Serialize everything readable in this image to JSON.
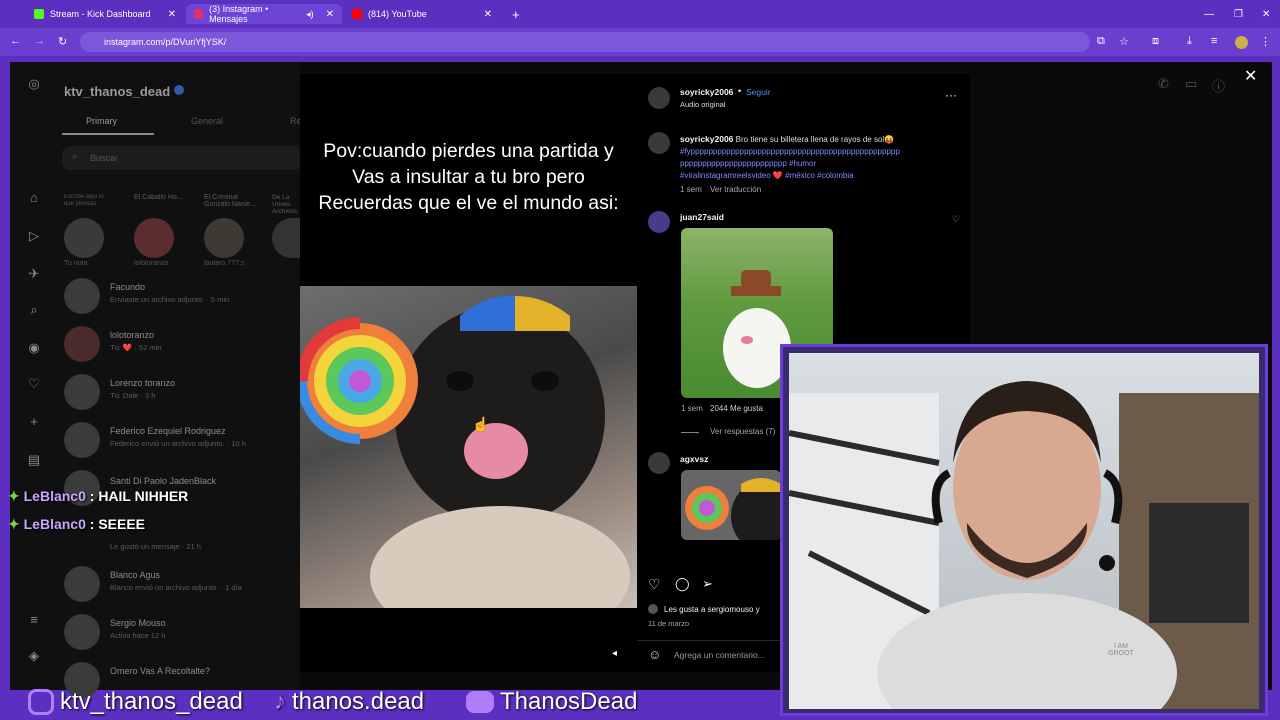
{
  "tabs": [
    {
      "label": "Stream - Kick Dashboard",
      "active": false
    },
    {
      "label": "(3) Instagram • Mensajes",
      "active": true
    },
    {
      "label": "(814) YouTube",
      "active": false
    }
  ],
  "address": {
    "url": "instagram.com/p/DVuriYfjYSK/"
  },
  "dm": {
    "username": "ktv_thanos_dead",
    "tabs": [
      "Primary",
      "General",
      "Re"
    ],
    "search_placeholder": "Buscar",
    "notes": [
      {
        "name": "Tu nota",
        "note": "Escribe aquí lo que piensas"
      },
      {
        "name": "lolotoranzo",
        "note": "El Caballo Ho..."
      },
      {
        "name": "lautaro.777.s",
        "note": "El Criminal Gonzalo Nasie..."
      },
      {
        "name": "",
        "note": "De La Urives Archivos"
      }
    ],
    "threads": [
      {
        "name": "Facundo",
        "sub": "Enviaste un archivo adjunto. · 5 min"
      },
      {
        "name": "lolotoranzo",
        "sub": "Tú: ❤️ · 52 min"
      },
      {
        "name": "Lorenzo toranzo",
        "sub": "Tú: Dale · 3 h"
      },
      {
        "name": "Federico Ezequiel Rodriguez",
        "sub": "Federico envió un archivo adjunto. · 10 h"
      },
      {
        "name": "Santi Di Paolo JadenBlack",
        "sub": ""
      },
      {
        "name": "",
        "sub": "Le gustó un mensaje · 21 h"
      },
      {
        "name": "Blanco Agus",
        "sub": "Blanco envió un archivo adjunto. · 1 día"
      },
      {
        "name": "Sergio Mouso",
        "sub": "Activo hace 12 h"
      },
      {
        "name": "Omero Vas A Recoltalte?",
        "sub": ""
      }
    ]
  },
  "reel": {
    "caption_lines": [
      "Pov:cuando pierdes una partida y",
      "Vas a insultar a tu bro pero",
      "Recuerdas que el ve el mundo asi:"
    ]
  },
  "post": {
    "author": "soyricky2006",
    "follow": "Seguir",
    "audio": "Audio original",
    "caption_author": "soyricky2006",
    "caption_text": "Bro tiene su billetera llena de rayos de sol😝",
    "hashtags_line1": "#fyppppppppppppppppppppppppppppppppppppppppppppppp",
    "hashtags_line2": "pppppppppppppppppppppppp #humor",
    "hashtags_line3": "#viralinstagramreelsvideo ❤️ #méxico #colombia",
    "caption_time": "1 sem",
    "translate": "Ver traducción",
    "comments": [
      {
        "user": "juan27said",
        "time": "1 sem",
        "likes": "2044 Me gusta",
        "replies": "Ver respuestas (7)"
      },
      {
        "user": "agxvsz"
      }
    ],
    "liked_by": "Les gusta a sergiomouso y",
    "date": "11 de marzo",
    "comment_placeholder": "Agrega un comentario..."
  },
  "chat": [
    {
      "user": "LeBlanc0",
      "text": ": HAIL NIHHER"
    },
    {
      "user": "LeBlanc0",
      "text": ": SEEEE"
    }
  ],
  "socials": [
    {
      "icon": "instagram-icon",
      "handle": "ktv_thanos_dead"
    },
    {
      "icon": "tiktok-icon",
      "handle": "thanos.dead"
    },
    {
      "icon": "discord-icon",
      "handle": "ThanosDead"
    }
  ],
  "webcam": {
    "shirt_text": "I AM GROOT"
  },
  "colors": {
    "frame": "#5b2fc0",
    "link": "#7e8cff"
  }
}
